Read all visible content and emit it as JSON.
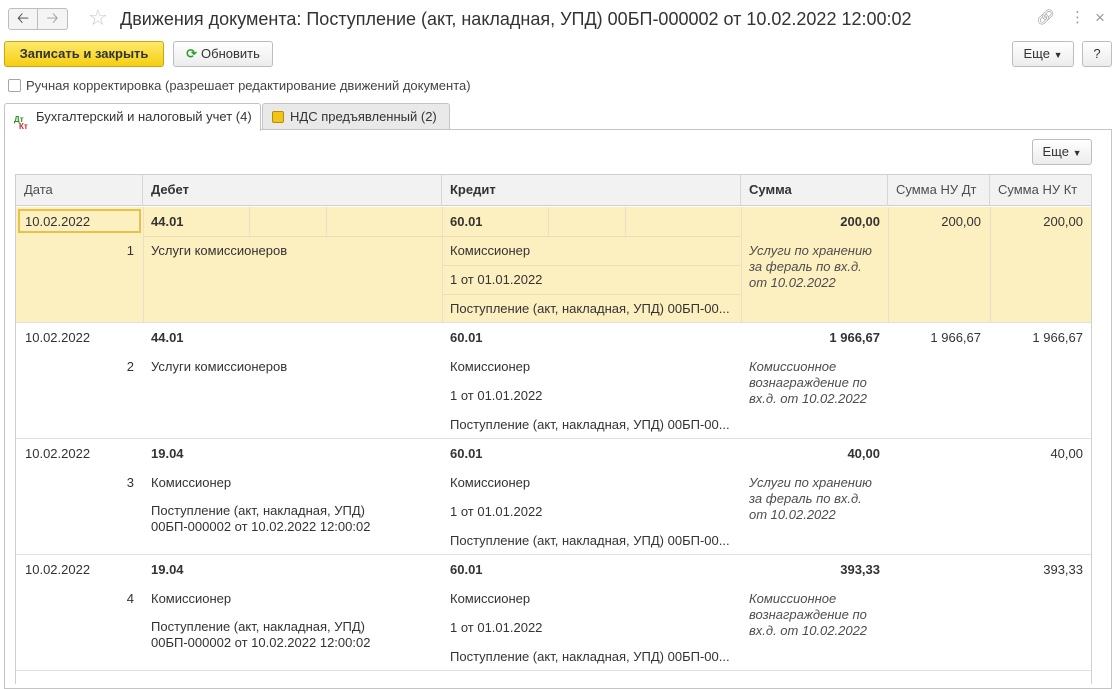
{
  "window": {
    "title": "Движения документа: Поступление (акт, накладная, УПД) 00БП-000002 от 10.02.2022 12:00:02"
  },
  "toolbar": {
    "save_close_label": "Записать и закрыть",
    "refresh_label": "Обновить",
    "more_label": "Еще",
    "help_label": "?"
  },
  "manual_correction_label": "Ручная корректировка (разрешает редактирование движений документа)",
  "tabs": [
    {
      "label": "Бухгалтерский и налоговый учет (4)"
    },
    {
      "label": "НДС предъявленный (2)"
    }
  ],
  "table": {
    "more_label": "Еще",
    "columns": [
      "Дата",
      "Дебет",
      "Кредит",
      "Сумма",
      "Сумма НУ Дт",
      "Сумма НУ Кт"
    ],
    "rows": [
      {
        "date": "10.02.2022",
        "num": "1",
        "debit_account": "44.01",
        "debit_sub1": "Услуги комиссионеров",
        "debit_sub2": "",
        "credit_account": "60.01",
        "credit_sub1": "Комиссионер",
        "credit_sub2": "1 от 01.01.2022",
        "credit_sub3": "Поступление (акт, накладная, УПД) 00БП-00...",
        "amount": "200,00",
        "content_line1": "Услуги по хранению",
        "content_line2": "за фераль по вх.д.",
        "content_line3": "от 10.02.2022",
        "nu_dt": "200,00",
        "nu_kt": "200,00"
      },
      {
        "date": "10.02.2022",
        "num": "2",
        "debit_account": "44.01",
        "debit_sub1": "Услуги комиссионеров",
        "debit_sub2": "",
        "credit_account": "60.01",
        "credit_sub1": "Комиссионер",
        "credit_sub2": "1 от 01.01.2022",
        "credit_sub3": "Поступление (акт, накладная, УПД) 00БП-00...",
        "amount": "1 966,67",
        "content_line1": "Комиссионное",
        "content_line2": "вознаграждение по",
        "content_line3": "вх.д.  от 10.02.2022",
        "nu_dt": "1 966,67",
        "nu_kt": "1 966,67"
      },
      {
        "date": "10.02.2022",
        "num": "3",
        "debit_account": "19.04",
        "debit_sub1": "Комиссионер",
        "debit_sub2": "Поступление (акт, накладная, УПД)",
        "debit_sub3": "00БП-000002 от 10.02.2022 12:00:02",
        "credit_account": "60.01",
        "credit_sub1": "Комиссионер",
        "credit_sub2": "1 от 01.01.2022",
        "credit_sub3": "Поступление (акт, накладная, УПД) 00БП-00...",
        "amount": "40,00",
        "content_line1": "Услуги по хранению",
        "content_line2": "за фераль по вх.д.",
        "content_line3": "от 10.02.2022",
        "nu_dt": "",
        "nu_kt": "40,00"
      },
      {
        "date": "10.02.2022",
        "num": "4",
        "debit_account": "19.04",
        "debit_sub1": "Комиссионер",
        "debit_sub2": "Поступление (акт, накладная, УПД)",
        "debit_sub3": "00БП-000002 от 10.02.2022 12:00:02",
        "credit_account": "60.01",
        "credit_sub1": "Комиссионер",
        "credit_sub2": "1 от 01.01.2022",
        "credit_sub3": "Поступление (акт, накладная, УПД) 00БП-00...",
        "amount": "393,33",
        "content_line1": "Комиссионное",
        "content_line2": "вознаграждение по",
        "content_line3": "вх.д.  от 10.02.2022",
        "nu_dt": "",
        "nu_kt": "393,33"
      }
    ]
  },
  "icons": {
    "back": "arrow-left-icon",
    "forward": "arrow-right-icon",
    "favorite": "star-icon",
    "link": "link-icon",
    "menu": "more-vertical-icon",
    "close": "close-icon",
    "refresh": "refresh-icon",
    "tab1": "dt-kt-icon",
    "tab2": "vat-icon"
  },
  "colors": {
    "primary_button": "#f6cf12",
    "selected_row": "#fdf0c0",
    "selected_cell_border": "#e6c24a",
    "refresh_icon": "#2a9a2a"
  }
}
